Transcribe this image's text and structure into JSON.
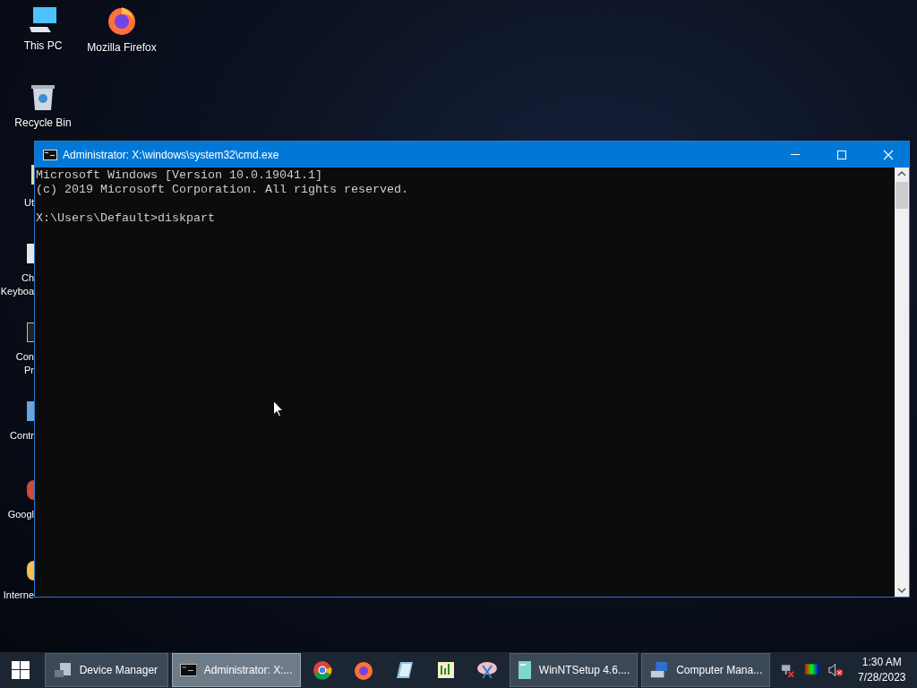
{
  "desktop_icons": [
    {
      "label": "This PC"
    },
    {
      "label": "Mozilla Firefox"
    },
    {
      "label": "Recycle Bin"
    }
  ],
  "hidden_icons": [
    {
      "lines": [
        "Ut"
      ]
    },
    {
      "lines": [
        "Ch",
        "Keyboa"
      ]
    },
    {
      "lines": [
        "Con",
        "Pr"
      ]
    },
    {
      "lines": [
        "Contr"
      ]
    },
    {
      "lines": [
        "Googl"
      ]
    },
    {
      "lines": [
        "Interne"
      ]
    }
  ],
  "window": {
    "title": "Administrator: X:\\windows\\system32\\cmd.exe",
    "blocks": [
      [
        "Microsoft Windows [Version 10.0.19041.1]",
        "(c) 2019 Microsoft Corporation. All rights reserved."
      ],
      [
        "X:\\Users\\Default>diskpart"
      ]
    ]
  },
  "taskbar": {
    "items": [
      {
        "kind": "button",
        "label": "Device Manager",
        "selected": false
      },
      {
        "kind": "button",
        "label": "Administrator: X:...",
        "selected": true
      },
      {
        "kind": "pin"
      },
      {
        "kind": "pin"
      },
      {
        "kind": "pin"
      },
      {
        "kind": "pin"
      },
      {
        "kind": "pin"
      },
      {
        "kind": "button",
        "label": "WinNTSetup 4.6....",
        "selected": false
      },
      {
        "kind": "button",
        "label": "Computer Mana...",
        "selected": false
      }
    ],
    "clock": {
      "time": "1:30 AM",
      "date": "7/28/2023"
    }
  }
}
